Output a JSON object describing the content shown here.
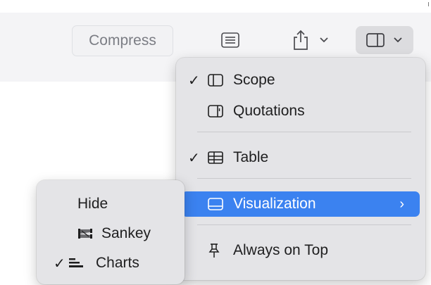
{
  "toolbar": {
    "compress_label": "Compress",
    "doc_icon": "document-icon",
    "share_icon": "share-icon",
    "layout_icon": "sidebar-layout-icon"
  },
  "view_menu": {
    "items": [
      {
        "label": "Scope",
        "checked": true,
        "icon": "sidebar-left-icon"
      },
      {
        "label": "Quotations",
        "checked": false,
        "icon": "sidebar-right-icon"
      },
      {
        "label": "Table",
        "checked": true,
        "icon": "table-icon"
      },
      {
        "label": "Visualization",
        "checked": false,
        "icon": "panel-bottom-icon",
        "has_submenu": true
      },
      {
        "label": "Always on Top",
        "checked": false,
        "icon": "pin-icon"
      }
    ],
    "check_glyph": "✓",
    "submenu_glyph": "›"
  },
  "visualization_submenu": {
    "items": [
      {
        "label": "Hide",
        "checked": false
      },
      {
        "label": "Sankey",
        "checked": false,
        "icon": "sankey-icon"
      },
      {
        "label": "Charts",
        "checked": true,
        "icon": "charts-icon"
      }
    ]
  },
  "colors": {
    "highlight": "#3b82f0",
    "menu_bg": "#e4e4e7"
  }
}
